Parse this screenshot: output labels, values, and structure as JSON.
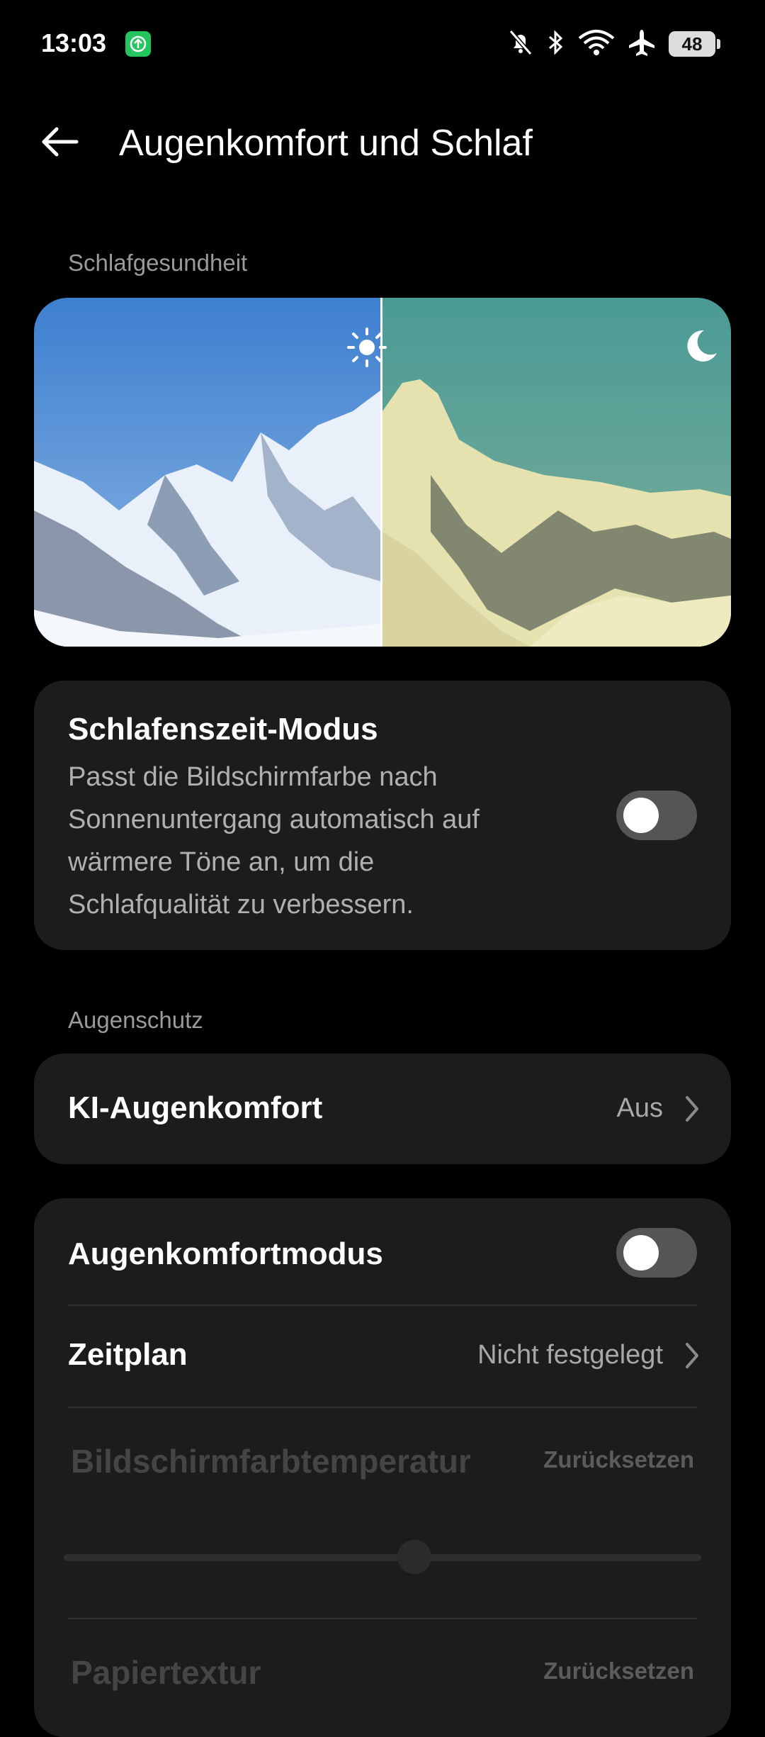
{
  "status_bar": {
    "time": "13:03",
    "battery": "48",
    "icons": [
      "app-notification-icon",
      "mute-icon",
      "bluetooth-icon",
      "wifi-icon",
      "airplane-icon",
      "battery-icon"
    ]
  },
  "header": {
    "title": "Augenkomfort und Schlaf",
    "back_icon": "back-arrow-icon"
  },
  "sleep_section": {
    "label": "Schlafgesundheit",
    "icons": [
      "sun-icon",
      "moon-icon"
    ]
  },
  "bedtime_mode": {
    "title": "Schlafenszeit-Modus",
    "description": "Passt die Bildschirmfarbe nach Sonnenuntergang automatisch auf wärmere Töne an, um die Schlafqualität zu verbessern.",
    "enabled": false
  },
  "eye_section": {
    "label": "Augenschutz"
  },
  "ai_eye_comfort": {
    "label": "KI-Augenkomfort",
    "value": "Aus"
  },
  "eye_comfort_card": {
    "mode_label": "Augenkomfortmodus",
    "mode_enabled": false,
    "schedule_label": "Zeitplan",
    "schedule_value": "Nicht festgelegt",
    "color_temp_label": "Bildschirmfarbtemperatur",
    "color_temp_reset": "Zurücksetzen",
    "color_temp_level": 0.55,
    "paper_texture_label": "Papiertextur",
    "paper_texture_reset": "Zurücksetzen"
  },
  "colors": {
    "background": "#000000",
    "card": "#1c1c1c",
    "toggle_off": "#555555",
    "secondary_text": "#b0b0b0"
  }
}
